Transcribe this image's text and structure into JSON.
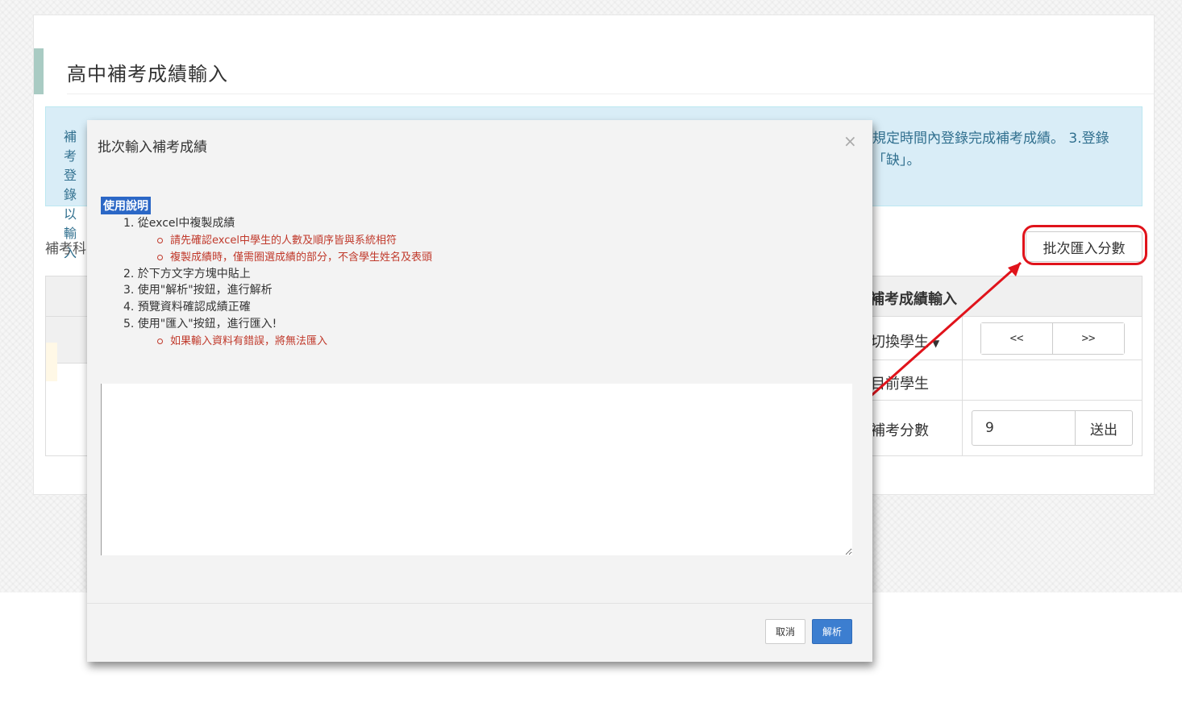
{
  "page": {
    "title": "高中補考成績輸入"
  },
  "alert": {
    "left_text": "補考\n登錄\n以\n輸入",
    "line1": "規定時間內登錄完成補考成績。 3.登錄",
    "line2": "「缺」。"
  },
  "subject_label": "補考科",
  "batch_import_button": "批次匯入分數",
  "right_panel": {
    "heading": "補考成績輸入",
    "switch_student_label": "切換學生",
    "prev_label": "<<",
    "next_label": ">>",
    "current_student_label": "目前學生",
    "score_label": "補考分數",
    "score_value": "9",
    "submit_label": "送出"
  },
  "modal": {
    "title": "批次輸入補考成績",
    "close_symbol": "×",
    "usage_badge": "使用說明",
    "steps": [
      {
        "text": "1. 從excel中複製成績",
        "subs": [
          "請先確認excel中學生的人數及順序皆與系統相符",
          "複製成績時，僅需圈選成績的部分，不含學生姓名及表頭"
        ]
      },
      {
        "text": "2. 於下方文字方塊中貼上",
        "subs": []
      },
      {
        "text": "3. 使用\"解析\"按鈕，進行解析",
        "subs": []
      },
      {
        "text": "4. 預覽資料確認成績正確",
        "subs": []
      },
      {
        "text": "5. 使用\"匯入\"按鈕，進行匯入!",
        "subs": [
          "如果輸入資料有錯誤，將無法匯入"
        ]
      }
    ],
    "cancel_label": "取消",
    "parse_label": "解析"
  },
  "colors": {
    "accent_blue": "#3c7ed0",
    "annotation_red": "#e0131b",
    "alert_bg": "#d9edf7",
    "title_accent": "#a9cbc3"
  }
}
